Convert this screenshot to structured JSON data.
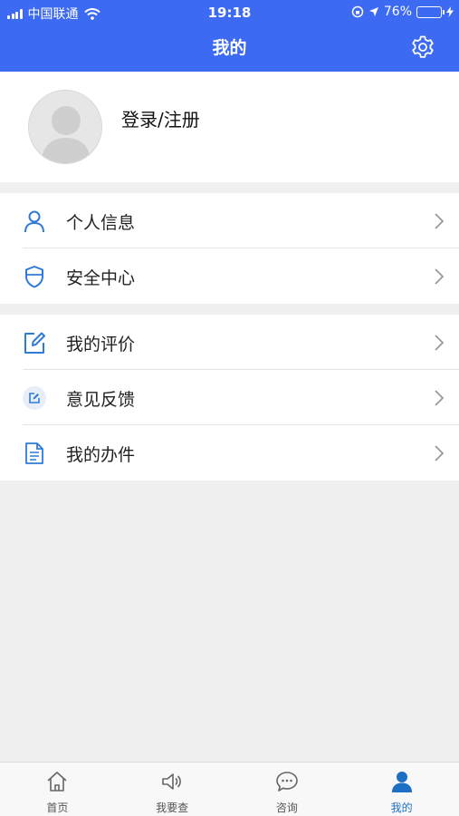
{
  "status_bar": {
    "carrier": "中国联通",
    "time": "19:18",
    "battery": "76%",
    "battery_level": 0.76
  },
  "header": {
    "title": "我的",
    "settings_icon": "gear-icon"
  },
  "profile": {
    "login_label": "登录/注册",
    "avatar_icon": "avatar-placeholder"
  },
  "menu": {
    "group1": [
      {
        "label": "个人信息",
        "icon": "user-icon"
      },
      {
        "label": "安全中心",
        "icon": "shield-icon"
      }
    ],
    "group2": [
      {
        "label": "我的评价",
        "icon": "edit-icon"
      },
      {
        "label": "意见反馈",
        "icon": "feedback-icon"
      },
      {
        "label": "我的办件",
        "icon": "document-icon"
      }
    ]
  },
  "tabbar": {
    "items": [
      {
        "label": "首页",
        "icon": "home-icon"
      },
      {
        "label": "我要查",
        "icon": "speaker-icon"
      },
      {
        "label": "咨询",
        "icon": "chat-icon"
      },
      {
        "label": "我的",
        "icon": "person-icon",
        "active": true
      }
    ]
  },
  "colors": {
    "primary": "#3d6af2",
    "icon_blue": "#2f7bd6",
    "background": "#f0f0f0",
    "tab_active": "#1d6fc4"
  }
}
